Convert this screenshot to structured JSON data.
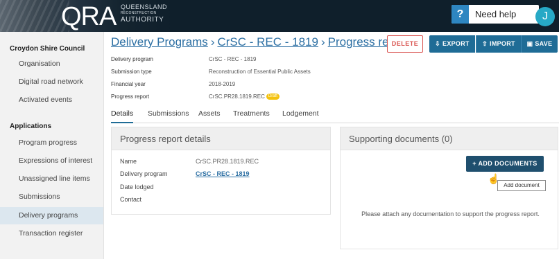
{
  "header": {
    "logo_text": "QRA",
    "logo_sub": [
      "QUEENSLAND",
      "RECONSTRUCTION",
      "AUTHORITY"
    ],
    "help_icon": "?",
    "help_label": "Need help",
    "avatar_initial": "J"
  },
  "sidebar": {
    "org_title": "Croydon Shire Council",
    "org_items": [
      {
        "label": "Organisation"
      },
      {
        "label": "Digital road network"
      },
      {
        "label": "Activated events"
      }
    ],
    "apps_title": "Applications",
    "app_items": [
      {
        "label": "Program progress"
      },
      {
        "label": "Expressions of interest"
      },
      {
        "label": "Unassigned line items"
      },
      {
        "label": "Submissions"
      },
      {
        "label": "Delivery programs",
        "active": true
      },
      {
        "label": "Transaction register"
      }
    ]
  },
  "breadcrumb": {
    "items": [
      "Delivery Programs",
      "CrSC - REC - 1819",
      "Progress rep..."
    ],
    "separator": "›"
  },
  "toolbar": {
    "delete_label": "DELETE",
    "export_label": "EXPORT",
    "import_label": "IMPORT",
    "save_label": "SAVE"
  },
  "meta": {
    "rows": [
      {
        "key": "Delivery program",
        "value": "CrSC - REC - 1819"
      },
      {
        "key": "Submission type",
        "value": "Reconstruction of Essential Public Assets"
      },
      {
        "key": "Financial year",
        "value": "2018-2019"
      },
      {
        "key": "Progress report",
        "value": "CrSC.PR28.1819.REC"
      }
    ],
    "draft_badge": "Draft"
  },
  "tabs": [
    {
      "label": "Details",
      "active": true
    },
    {
      "label": "Submissions"
    },
    {
      "label": "Assets"
    },
    {
      "label": "Treatments"
    },
    {
      "label": "Lodgement"
    }
  ],
  "details_panel": {
    "title": "Progress report details",
    "fields": [
      {
        "label": "Name",
        "value": "CrSC.PR28.1819.REC"
      },
      {
        "label": "Delivery program",
        "value": "CrSC - REC - 1819"
      },
      {
        "label": "Date lodged",
        "value": ""
      },
      {
        "label": "Contact",
        "value": ""
      }
    ]
  },
  "docs_panel": {
    "title": "Supporting documents (0)",
    "add_button": "+ ADD DOCUMENTS",
    "tooltip": "Add document",
    "message": "Please attach any documentation to support the progress report."
  },
  "colors": {
    "topbar": "#0f1f2b",
    "primary": "#1f6c96",
    "link": "#2c6fa3",
    "danger": "#d9534f",
    "draft": "#f4c20d"
  }
}
